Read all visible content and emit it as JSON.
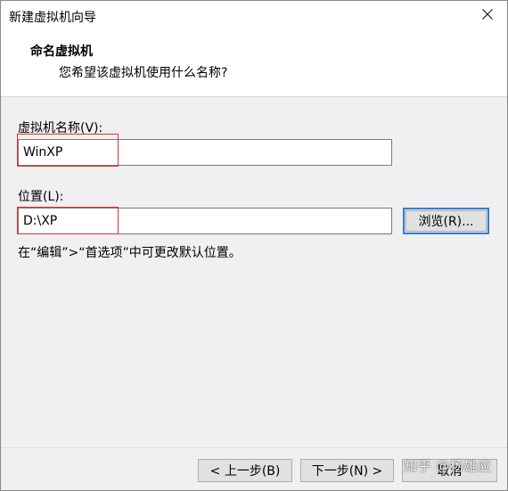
{
  "window": {
    "title": "新建虚拟机向导"
  },
  "header": {
    "title": "命名虚拟机",
    "subtitle": "您希望该虚拟机使用什么名称?"
  },
  "form": {
    "name_label": "虚拟机名称(V):",
    "name_value": "WinXP",
    "location_label": "位置(L):",
    "location_value": "D:\\XP",
    "browse_label": "浏览(R)...",
    "hint": "在“编辑”>“首选项”中可更改默认位置。"
  },
  "footer": {
    "back_label": "< 上一步(B)",
    "next_label": "下一步(N) >",
    "cancel_label": "取消"
  },
  "watermark": {
    "text": "知乎 @杨雄应"
  },
  "colors": {
    "highlight": "#e03131",
    "focus_border": "#2f7ed8"
  }
}
